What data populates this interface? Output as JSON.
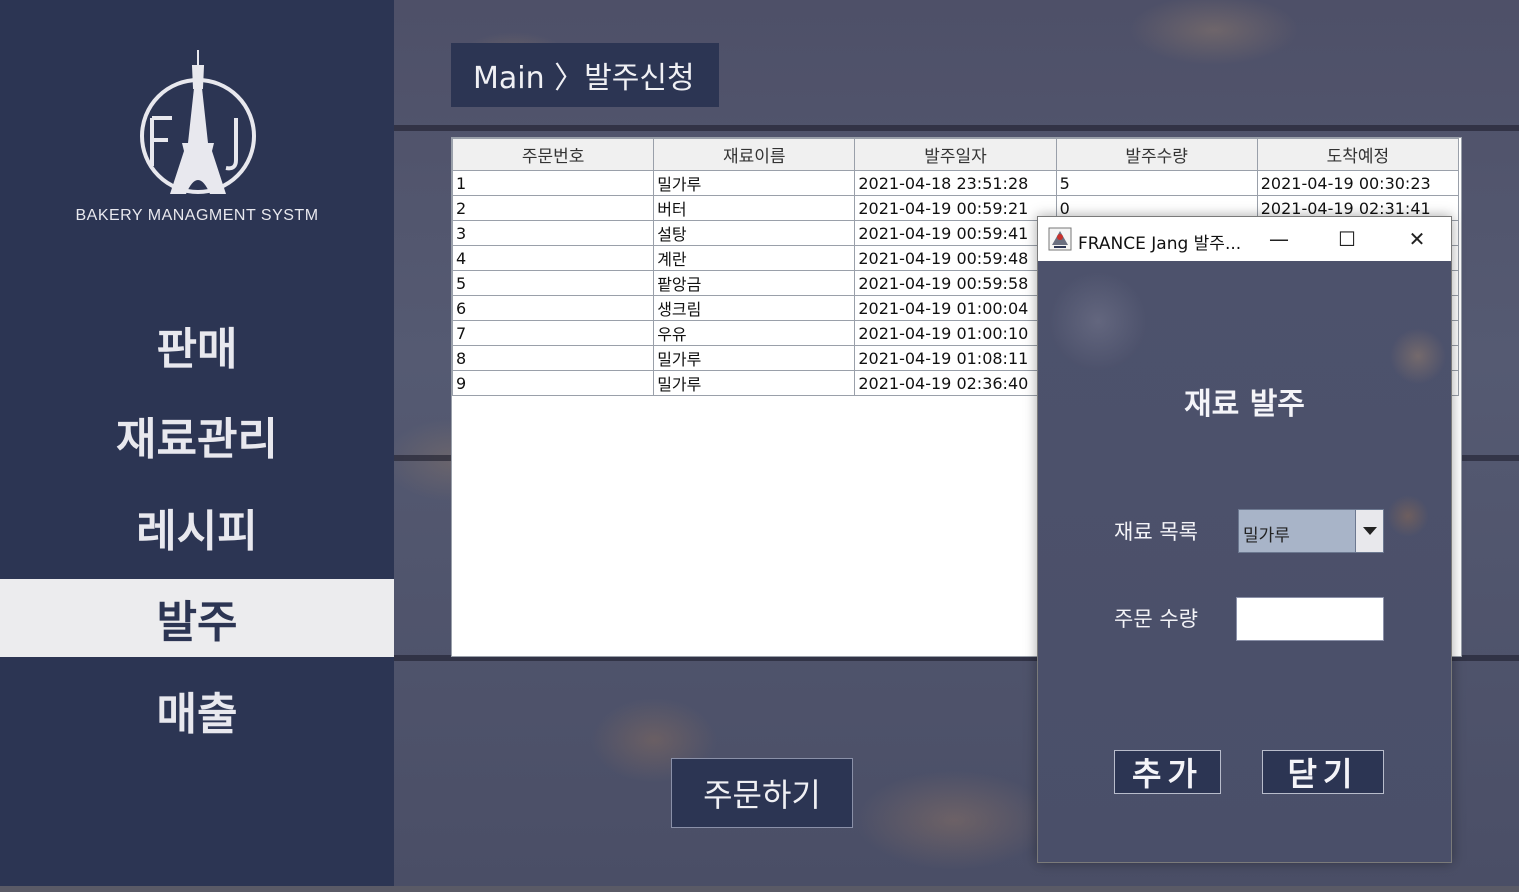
{
  "sidebar": {
    "logo_letters": "FAJ",
    "brand": "BAKERY MANAGMENT SYSTM",
    "items": [
      {
        "label": "판매"
      },
      {
        "label": "재료관리"
      },
      {
        "label": "레시피"
      },
      {
        "label": "발주",
        "active": true
      },
      {
        "label": "매출"
      }
    ]
  },
  "breadcrumb": "Main 〉발주신청",
  "table": {
    "columns": [
      "주문번호",
      "재료이름",
      "발주일자",
      "발주수량",
      "도착예정"
    ],
    "rows": [
      [
        "1",
        "밀가루",
        "2021-04-18 23:51:28",
        "5",
        "2021-04-19 00:30:23"
      ],
      [
        "2",
        "버터",
        "2021-04-19 00:59:21",
        "0",
        "2021-04-19 02:31:41"
      ],
      [
        "3",
        "설탕",
        "2021-04-19 00:59:41",
        "",
        ""
      ],
      [
        "4",
        "계란",
        "2021-04-19 00:59:48",
        "",
        ""
      ],
      [
        "5",
        "팥앙금",
        "2021-04-19 00:59:58",
        "",
        ""
      ],
      [
        "6",
        "생크림",
        "2021-04-19 01:00:04",
        "",
        ""
      ],
      [
        "7",
        "우유",
        "2021-04-19 01:00:10",
        "",
        ""
      ],
      [
        "8",
        "밀가루",
        "2021-04-19 01:08:11",
        "",
        ""
      ],
      [
        "9",
        "밀가루",
        "2021-04-19 02:36:40",
        "",
        ""
      ]
    ]
  },
  "order_button": "주문하기",
  "dialog": {
    "window_title": "FRANCE Jang 발주...",
    "minimize": "—",
    "maximize": "☐",
    "close": "✕",
    "heading": "재료 발주",
    "material_label": "재료 목록",
    "material_selected": "밀가루",
    "quantity_label": "주문 수량",
    "quantity_value": "",
    "add_button": "추가",
    "close_button": "닫기"
  }
}
